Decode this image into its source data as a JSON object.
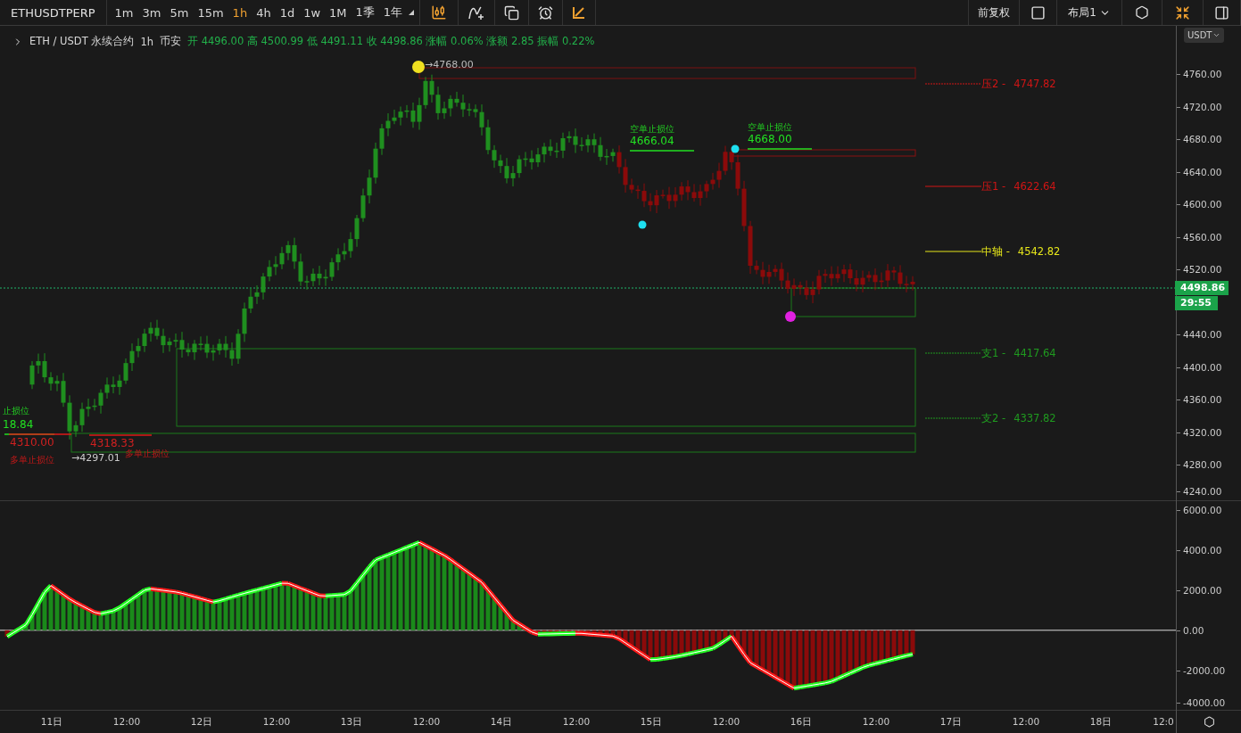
{
  "toolbar": {
    "symbol": "ETHUSDTPERP",
    "intervals": [
      {
        "label": "1m",
        "selected": false
      },
      {
        "label": "3m",
        "selected": false
      },
      {
        "label": "5m",
        "selected": false
      },
      {
        "label": "15m",
        "selected": false
      },
      {
        "label": "1h",
        "selected": true
      },
      {
        "label": "4h",
        "selected": false
      },
      {
        "label": "1d",
        "selected": false
      },
      {
        "label": "1w",
        "selected": false
      },
      {
        "label": "1M",
        "selected": false
      },
      {
        "label": "1季",
        "selected": false
      },
      {
        "label": "1年",
        "selected": false
      }
    ],
    "adjust_label": "前复权",
    "layout_label": "布局1"
  },
  "legend": {
    "title": "ETH / USDT 永续合约",
    "interval": "1h",
    "exchange": "币安",
    "stats": "开 4496.00 高 4500.99 低 4491.11 收 4498.86 涨幅 0.06% 涨额 2.85 振幅 0.22%"
  },
  "levels": [
    {
      "label": "压2 -",
      "value": "4747.82",
      "color": "#d01515"
    },
    {
      "label": "压1 -",
      "value": "4622.64",
      "color": "#d01515"
    },
    {
      "label": "中轴 -",
      "value": "4542.82",
      "color": "#e6e61a"
    },
    {
      "label": "支1 -",
      "value": "4417.64",
      "color": "#1f9a1f"
    },
    {
      "label": "支2 -",
      "value": "4337.82",
      "color": "#1f9a1f"
    }
  ],
  "stops": [
    {
      "kind": "above",
      "title": "空单止损位",
      "value": "4666.04"
    },
    {
      "kind": "above",
      "title": "空单止损位",
      "value": "4668.00"
    },
    {
      "kind": "above",
      "title": "止损位",
      "value": "18.84"
    },
    {
      "kind": "below",
      "title": "多单止损位",
      "value": "4310.00"
    },
    {
      "kind": "below",
      "title": "多单止损位",
      "value": "4318.33"
    }
  ],
  "extremes": [
    {
      "kind": "high",
      "text": "→4768.00"
    },
    {
      "kind": "low",
      "text": "→4297.01"
    }
  ],
  "price_axis": {
    "currency": "USDT",
    "ticks": [
      "4760.00",
      "4720.00",
      "4680.00",
      "4640.00",
      "4600.00",
      "4560.00",
      "4520.00",
      "4440.00",
      "4400.00",
      "4360.00",
      "4320.00",
      "4280.00",
      "4240.00"
    ],
    "last_price": "4498.86",
    "countdown": "29:55"
  },
  "indicator_axis": {
    "ticks": [
      "6000.00",
      "4000.00",
      "2000.00",
      "0.00",
      "-2000.00",
      "-4000.00"
    ]
  },
  "time_axis": [
    "11日",
    "12:00",
    "12日",
    "12:00",
    "13日",
    "12:00",
    "14日",
    "12:00",
    "15日",
    "12:00",
    "16日",
    "12:00",
    "17日",
    "12:00",
    "18日",
    "12:0"
  ]
}
